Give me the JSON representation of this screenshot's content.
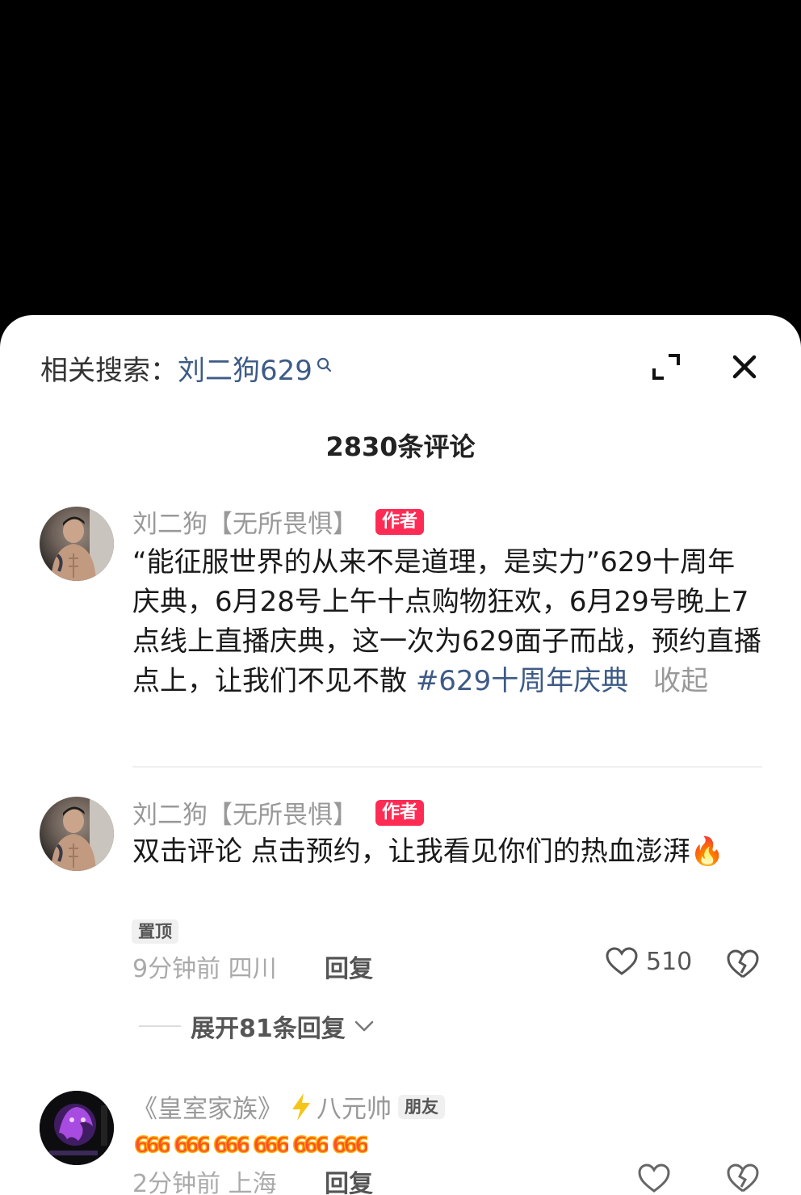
{
  "related": {
    "label": "相关搜索：",
    "term": "刘二狗629"
  },
  "header": {
    "comment_count": "2830条评论"
  },
  "comments": [
    {
      "username": "刘二狗【无所畏惧】",
      "badge": "作者",
      "text": "“能征服世界的从来不是道理，是实力”629十周年庆典，6月28号上午十点购物狂欢，6月29号晚上7点线上直播庆典，这一次为629面子而战，预约直播点上，让我们不见不散",
      "hashtag": "#629十周年庆典",
      "collapse_label": "收起"
    },
    {
      "username": "刘二狗【无所畏惧】",
      "badge": "作者",
      "text": "双击评论 点击预约，让我看见你们的热血澎湃",
      "emoji": "🔥",
      "pin_label": "置顶",
      "time_location": "9分钟前 四川",
      "reply_label": "回复",
      "likes": "510",
      "expand_label": "展开81条回复"
    },
    {
      "username_prefix": "《皇室家族》",
      "username_suffix": "八元帅",
      "badge": "朋友",
      "six_count": 6,
      "time_location": "2分钟前 上海",
      "reply_label": "回复"
    }
  ],
  "colors": {
    "accent_red": "#fe2c55",
    "link_blue": "#3d5b86",
    "muted": "#999999"
  }
}
